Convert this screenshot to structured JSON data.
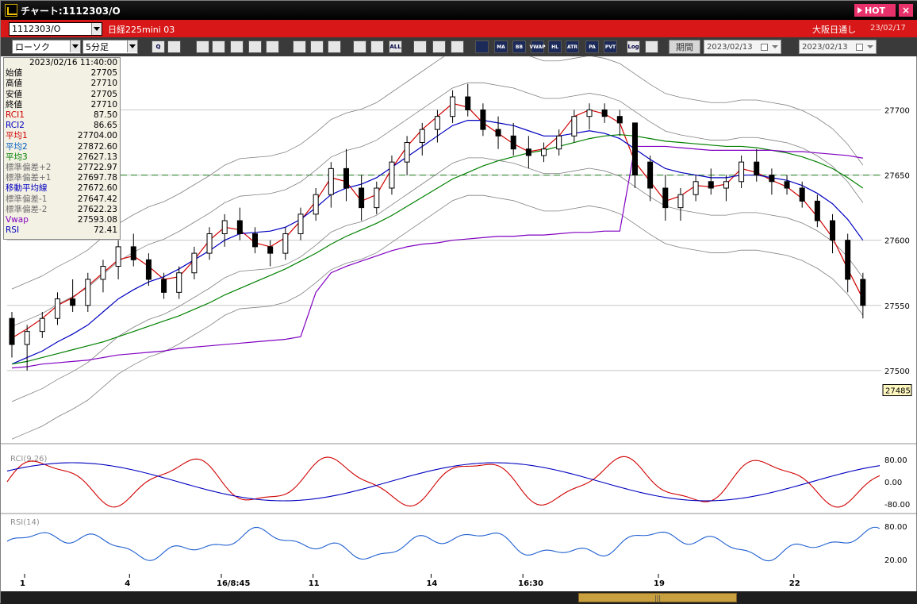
{
  "window": {
    "title": "チャート:1112303/O",
    "hot_label": "HOT",
    "close_label": "×"
  },
  "infobar": {
    "symbol": "1112303/O",
    "instrument": "日経225mini 03",
    "session": "大阪日通し",
    "date": "23/02/17"
  },
  "toolbar": {
    "chart_type": "ローソク",
    "interval": "5分足",
    "buttons": [
      "zoom",
      "grid",
      "buy",
      "sell",
      "mr",
      "rsi",
      "ind",
      "label",
      "pen",
      "pointer",
      "arrow",
      "marker",
      "tick",
      "all",
      "settings",
      "paint",
      "color",
      "trend",
      "MA",
      "BB",
      "VWAP",
      "HL",
      "ATR",
      "PARA",
      "PVT",
      "Log",
      "cursor"
    ],
    "period_label": "期間",
    "start_date": "2023/02/13",
    "range_sep": "~",
    "end_date": "2023/02/13"
  },
  "data_panel": {
    "datetime": "2023/02/16  11:40:00",
    "rows": [
      {
        "label": "始値",
        "value": "27705",
        "color": "#000000"
      },
      {
        "label": "高値",
        "value": "27710",
        "color": "#000000"
      },
      {
        "label": "安値",
        "value": "27705",
        "color": "#000000"
      },
      {
        "label": "終値",
        "value": "27710",
        "color": "#000000"
      },
      {
        "label": "RCI1",
        "value": "87.50",
        "color": "#d00000"
      },
      {
        "label": "RCI2",
        "value": "86.65",
        "color": "#0000c0"
      },
      {
        "label": "平均1",
        "value": "27704.00",
        "color": "#d00000"
      },
      {
        "label": "平均2",
        "value": "27872.60",
        "color": "#0060c0"
      },
      {
        "label": "平均3",
        "value": "27627.13",
        "color": "#008000"
      },
      {
        "label": "標準偏差+2",
        "value": "27722.97",
        "color": "#707070"
      },
      {
        "label": "標準偏差+1",
        "value": "27697.78",
        "color": "#707070"
      },
      {
        "label": "移動平均線",
        "value": "27672.60",
        "color": "#0000c0"
      },
      {
        "label": "標準偏差-1",
        "value": "27647.42",
        "color": "#707070"
      },
      {
        "label": "標準偏差-2",
        "value": "27622.23",
        "color": "#707070"
      },
      {
        "label": "Vwap",
        "value": "27593.08",
        "color": "#8000c0"
      },
      {
        "label": "RSI",
        "value": "72.41",
        "color": "#0000c0"
      }
    ]
  },
  "chart_data": {
    "type": "candlestick",
    "price_axis": {
      "ticks": [
        27500,
        27550,
        27600,
        27650,
        27700
      ],
      "ylim": [
        27450,
        27735
      ]
    },
    "current_price": "27485",
    "reference_line": 27650,
    "x_labels": [
      {
        "pos": 0.02,
        "text": "1"
      },
      {
        "pos": 0.14,
        "text": "4"
      },
      {
        "pos": 0.245,
        "text": "16/8:45"
      },
      {
        "pos": 0.35,
        "text": "11"
      },
      {
        "pos": 0.485,
        "text": "14"
      },
      {
        "pos": 0.59,
        "text": "16:30"
      },
      {
        "pos": 0.745,
        "text": "19"
      },
      {
        "pos": 0.9,
        "text": "22"
      }
    ],
    "candles": [
      [
        27540,
        27545,
        27510,
        27520
      ],
      [
        27520,
        27535,
        27500,
        27530
      ],
      [
        27530,
        27545,
        27525,
        27540
      ],
      [
        27540,
        27560,
        27535,
        27555
      ],
      [
        27555,
        27570,
        27545,
        27550
      ],
      [
        27550,
        27575,
        27545,
        27570
      ],
      [
        27570,
        27585,
        27560,
        27580
      ],
      [
        27580,
        27600,
        27570,
        27595
      ],
      [
        27595,
        27605,
        27580,
        27585
      ],
      [
        27585,
        27590,
        27565,
        27570
      ],
      [
        27570,
        27575,
        27555,
        27560
      ],
      [
        27560,
        27580,
        27555,
        27575
      ],
      [
        27575,
        27595,
        27570,
        27590
      ],
      [
        27590,
        27610,
        27585,
        27605
      ],
      [
        27605,
        27620,
        27595,
        27615
      ],
      [
        27615,
        27625,
        27600,
        27605
      ],
      [
        27605,
        27610,
        27590,
        27595
      ],
      [
        27595,
        27600,
        27580,
        27590
      ],
      [
        27590,
        27610,
        27585,
        27605
      ],
      [
        27605,
        27625,
        27600,
        27620
      ],
      [
        27620,
        27640,
        27615,
        27635
      ],
      [
        27635,
        27660,
        27625,
        27655
      ],
      [
        27655,
        27670,
        27630,
        27640
      ],
      [
        27640,
        27650,
        27615,
        27625
      ],
      [
        27625,
        27645,
        27620,
        27640
      ],
      [
        27640,
        27665,
        27635,
        27660
      ],
      [
        27660,
        27680,
        27650,
        27675
      ],
      [
        27675,
        27690,
        27665,
        27685
      ],
      [
        27685,
        27700,
        27675,
        27695
      ],
      [
        27695,
        27715,
        27690,
        27710
      ],
      [
        27710,
        27720,
        27695,
        27700
      ],
      [
        27700,
        27705,
        27680,
        27685
      ],
      [
        27685,
        27695,
        27670,
        27680
      ],
      [
        27680,
        27690,
        27665,
        27670
      ],
      [
        27670,
        27680,
        27655,
        27665
      ],
      [
        27665,
        27675,
        27660,
        27670
      ],
      [
        27670,
        27685,
        27665,
        27680
      ],
      [
        27680,
        27700,
        27675,
        27695
      ],
      [
        27695,
        27705,
        27685,
        27700
      ],
      [
        27700,
        27705,
        27690,
        27695
      ],
      [
        27695,
        27700,
        27680,
        27690
      ],
      [
        27690,
        27670,
        27640,
        27650
      ],
      [
        27660,
        27665,
        27630,
        27640
      ],
      [
        27640,
        27650,
        27615,
        27625
      ],
      [
        27625,
        27640,
        27615,
        27635
      ],
      [
        27635,
        27650,
        27630,
        27645
      ],
      [
        27645,
        27655,
        27635,
        27640
      ],
      [
        27640,
        27650,
        27630,
        27645
      ],
      [
        27645,
        27665,
        27640,
        27660
      ],
      [
        27660,
        27670,
        27645,
        27650
      ],
      [
        27650,
        27655,
        27635,
        27645
      ],
      [
        27645,
        27650,
        27635,
        27640
      ],
      [
        27640,
        27645,
        27625,
        27630
      ],
      [
        27630,
        27635,
        27610,
        27615
      ],
      [
        27615,
        27620,
        27590,
        27600
      ],
      [
        27600,
        27605,
        27560,
        27570
      ],
      [
        27570,
        27575,
        27540,
        27550
      ]
    ],
    "series": [
      {
        "name": "平均1",
        "color": "#d00000",
        "values": [
          27525,
          27532,
          27540,
          27550,
          27556,
          27565,
          27575,
          27585,
          27588,
          27580,
          27570,
          27572,
          27585,
          27600,
          27610,
          27608,
          27598,
          27595,
          27602,
          27615,
          27630,
          27648,
          27645,
          27630,
          27635,
          27655,
          27672,
          27685,
          27695,
          27705,
          27702,
          27690,
          27682,
          27674,
          27668,
          27670,
          27680,
          27695,
          27700,
          27697,
          27690,
          27660,
          27645,
          27630,
          27634,
          27642,
          27641,
          27643,
          27655,
          27652,
          27646,
          27641,
          27632,
          27618,
          27602,
          27578,
          27555
        ]
      },
      {
        "name": "平均2",
        "color": "#0000c0",
        "values": [
          27505,
          27510,
          27515,
          27522,
          27528,
          27535,
          27545,
          27555,
          27562,
          27568,
          27572,
          27578,
          27585,
          27592,
          27600,
          27605,
          27606,
          27607,
          27610,
          27616,
          27625,
          27635,
          27640,
          27643,
          27648,
          27656,
          27664,
          27672,
          27680,
          27688,
          27692,
          27692,
          27690,
          27688,
          27684,
          27680,
          27680,
          27682,
          27684,
          27682,
          27678,
          27670,
          27662,
          27655,
          27652,
          27650,
          27648,
          27648,
          27650,
          27650,
          27648,
          27646,
          27642,
          27636,
          27628,
          27616,
          27600
        ]
      },
      {
        "name": "平均3",
        "color": "#008000",
        "values": [
          27505,
          27507,
          27510,
          27513,
          27516,
          27519,
          27522,
          27526,
          27530,
          27534,
          27538,
          27542,
          27547,
          27552,
          27558,
          27563,
          27568,
          27573,
          27578,
          27584,
          27590,
          27597,
          27603,
          27608,
          27613,
          27619,
          27626,
          27633,
          27640,
          27647,
          27652,
          27657,
          27661,
          27664,
          27667,
          27669,
          27672,
          27675,
          27678,
          27680,
          27681,
          27680,
          27678,
          27676,
          27675,
          27674,
          27673,
          27672,
          27672,
          27671,
          27669,
          27667,
          27664,
          27660,
          27655,
          27648,
          27640
        ]
      },
      {
        "name": "Vwap",
        "color": "#8000c0",
        "values": [
          27502,
          27503,
          27505,
          27506,
          27507,
          27508,
          27510,
          27512,
          27513,
          27514,
          27515,
          27517,
          27518,
          27519,
          27520,
          27521,
          27522,
          27523,
          27524,
          27526,
          27560,
          27575,
          27580,
          27584,
          27588,
          27592,
          27595,
          27597,
          27598,
          27600,
          27601,
          27602,
          27603,
          27603,
          27604,
          27604,
          27605,
          27606,
          27606,
          27607,
          27607,
          27672,
          27672,
          27672,
          27671,
          27670,
          27669,
          27669,
          27669,
          27669,
          27669,
          27668,
          27668,
          27667,
          27666,
          27665,
          27663
        ]
      }
    ],
    "rci": {
      "label": "RCI(9,26)",
      "ticks": [
        "80.00",
        "0.00",
        "-80.00"
      ],
      "series": [
        {
          "name": "RCI1",
          "color": "#d00000"
        },
        {
          "name": "RCI2",
          "color": "#0000c0"
        }
      ]
    },
    "rsi": {
      "label": "RSI(14)",
      "ticks": [
        "80.00",
        "20.00"
      ]
    }
  }
}
